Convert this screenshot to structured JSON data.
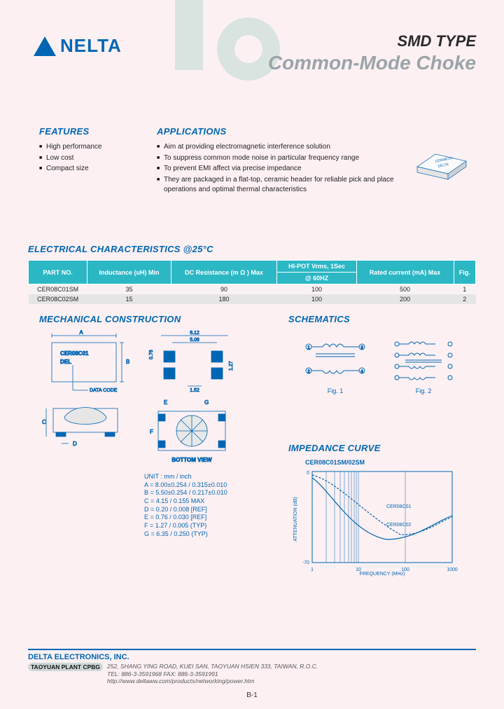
{
  "logo": {
    "text": "NELTA"
  },
  "title": {
    "smd": "SMD TYPE",
    "cmc": "Common-Mode Choke"
  },
  "features": {
    "heading": "FEATURES",
    "items": [
      "High performance",
      "Low cost",
      "Compact size"
    ]
  },
  "applications": {
    "heading": "APPLICATIONS",
    "items": [
      "Aim at providing electromagnetic interference solution",
      "To suppress common mode noise in particular frequency range",
      "To prevent EMI affect via precise impedance",
      "They are packaged in a flat-top, ceramic header for reliable pick and place operations and optimal thermal characteristics"
    ]
  },
  "chip_label": "CER08C01",
  "chip_brand": "DELTA",
  "elec": {
    "heading": "ELECTRICAL CHARACTERISTICS @25°C",
    "headers": {
      "part": "PART NO.",
      "ind": "Inductance (uH) Min",
      "dcr": "DC Resistance (m Ω ) Max",
      "hipot": "HI-POT Vrms, 1Sec",
      "hipot_sub": "@ 60HZ",
      "rated": "Rated current (mA) Max",
      "fig": "Fig."
    },
    "rows": [
      {
        "part": "CER08C01SM",
        "ind": "35",
        "dcr": "90",
        "hipot": "100",
        "rated": "500",
        "fig": "1"
      },
      {
        "part": "CER08C02SM",
        "ind": "15",
        "dcr": "180",
        "hipot": "100",
        "rated": "200",
        "fig": "2"
      }
    ]
  },
  "mech": {
    "heading": "MECHANICAL CONSTRUCTION",
    "part_label": "CER08C01",
    "del_label": "DEL",
    "data_code": "DATA CODE",
    "bottom_view": "BOTTOM VIEW",
    "dims": {
      "w": "8.12",
      "pad": "5.08",
      "gap": "1.52",
      "h1": "0.76",
      "h2": "1.27"
    },
    "unit_head": "UNIT : mm / inch",
    "units": [
      "A = 8.00±0.254 / 0.315±0.010",
      "B = 5.50±0.254 / 0.217±0.010",
      "C = 4.15 / 0.155 MAX",
      "D = 0.20 / 0.008 [REF]",
      "E = 0.76 / 0.030 [REF]",
      "F = 1.27 / 0.005 (TYP)",
      "G = 6.35 / 0.250 (TYP)"
    ]
  },
  "schem": {
    "heading": "SCHEMATICS",
    "fig1": "Fig. 1",
    "fig2": "Fig. 2"
  },
  "imped": {
    "heading": "IMPEDANCE CURVE",
    "chart_models": "CER08C01SM/02SM",
    "ylabel": "ATTENUATION (dB)",
    "xlabel": "FREQUENCY (MHz)",
    "trace1": "CER08C01",
    "trace2": "CER08C02"
  },
  "chart_data": {
    "type": "line",
    "title": "CER08C01SM/02SM",
    "xlabel": "FREQUENCY (MHz)",
    "ylabel": "ATTENUATION (dB)",
    "x_scale": "log",
    "xlim": [
      1,
      1000
    ],
    "ylim": [
      -70,
      0
    ],
    "x": [
      1,
      2,
      5,
      10,
      20,
      50,
      100,
      200,
      500,
      1000
    ],
    "series": [
      {
        "name": "CER08C01",
        "values": [
          -5,
          -15,
          -30,
          -42,
          -50,
          -52,
          -48,
          -42,
          -36,
          -34
        ]
      },
      {
        "name": "CER08C02",
        "values": [
          -3,
          -8,
          -18,
          -28,
          -38,
          -46,
          -48,
          -44,
          -38,
          -35
        ]
      }
    ]
  },
  "footer": {
    "company": "DELTA ELECTRONICS, INC.",
    "plant": "TAOYUAN PLANT CPBG",
    "addr_line1": "252, SHANG YING ROAD, KUEI SAN, TAOYUAN HSIEN 333, TAIWAN, R.O.C.",
    "addr_line2": "TEL: 886-3-3591968   FAX: 886-3-3591991",
    "addr_line3": "http://www.deltaww.com/products/networking/power.htm"
  },
  "page_num": "B-1"
}
